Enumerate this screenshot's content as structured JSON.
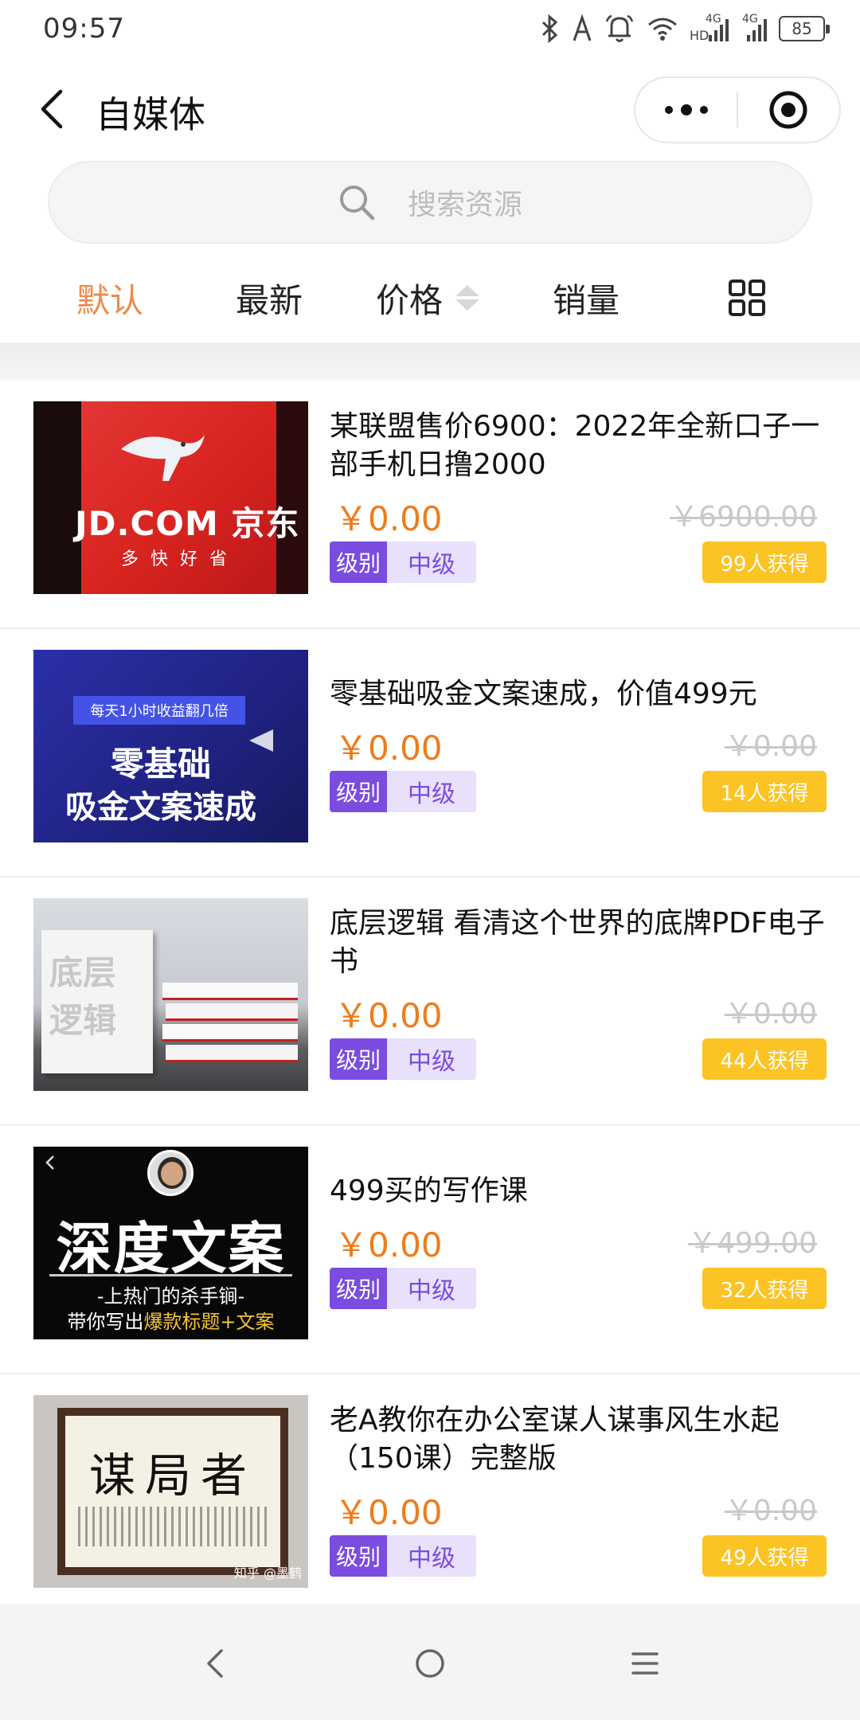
{
  "status_bar": {
    "time": "09:57",
    "network_1": "4G",
    "network_2": "4G",
    "hd": "HD",
    "battery": "85",
    "icons": [
      "bluetooth-icon",
      "location-icon",
      "alarm-icon",
      "wifi-icon",
      "signal-icon",
      "signal-icon",
      "battery-icon"
    ]
  },
  "nav": {
    "title": "自媒体",
    "icons": [
      "back-icon",
      "more-icon",
      "target-icon"
    ]
  },
  "search": {
    "placeholder": "搜索资源",
    "icon": "search-icon"
  },
  "sort_tabs": [
    {
      "label": "默认",
      "active": true
    },
    {
      "label": "最新",
      "active": false
    },
    {
      "label": "价格",
      "active": false,
      "icon": "sort-arrows-icon"
    },
    {
      "label": "销量",
      "active": false
    },
    {
      "icon": "grid-icon"
    }
  ],
  "colors": {
    "accent": "#f08a4b",
    "price": "#f07b1a",
    "level_tag": "#7a4ce0",
    "sold_badge": "#fcc325"
  },
  "items": [
    {
      "title": "某联盟售价6900：2022年全新口子一部手机日撸2000",
      "price": "￥0.00",
      "original_price": "￥6900.00",
      "level_key": "级别",
      "level_value": "中级",
      "sold": "99人获得",
      "thumb": {
        "main": "JD.COM 京东",
        "sub": "多 快 好 省"
      }
    },
    {
      "title": "零基础吸金文案速成，价值499元",
      "price": "￥0.00",
      "original_price": "￥0.00",
      "level_key": "级别",
      "level_value": "中级",
      "sold": "14人获得",
      "thumb": {
        "banner": "每天1小时收益翻几倍",
        "line1": "零基础",
        "line2": "吸金文案速成"
      }
    },
    {
      "title": "底层逻辑 看清这个世界的底牌PDF电子书",
      "price": "￥0.00",
      "original_price": "￥0.00",
      "level_key": "级别",
      "level_value": "中级",
      "sold": "44人获得",
      "thumb": {
        "line1": "底层",
        "line2": "逻辑"
      }
    },
    {
      "title": "499买的写作课",
      "price": "￥0.00",
      "original_price": "￥499.00",
      "level_key": "级别",
      "level_value": "中级",
      "sold": "32人获得",
      "thumb": {
        "main": "深度文案",
        "sub": "-上热门的杀手锏-",
        "line3a": "带你写出",
        "line3b": "爆款标题+文案"
      }
    },
    {
      "title": "老A教你在办公室谋人谋事风生水起（150课）完整版",
      "price": "￥0.00",
      "original_price": "￥0.00",
      "level_key": "级别",
      "level_value": "中级",
      "sold": "49人获得",
      "thumb": {
        "main": "谋局者",
        "watermark": "知乎 @墨鹤"
      }
    }
  ],
  "system_nav": [
    "back-nav-icon",
    "home-nav-icon",
    "menu-nav-icon"
  ]
}
